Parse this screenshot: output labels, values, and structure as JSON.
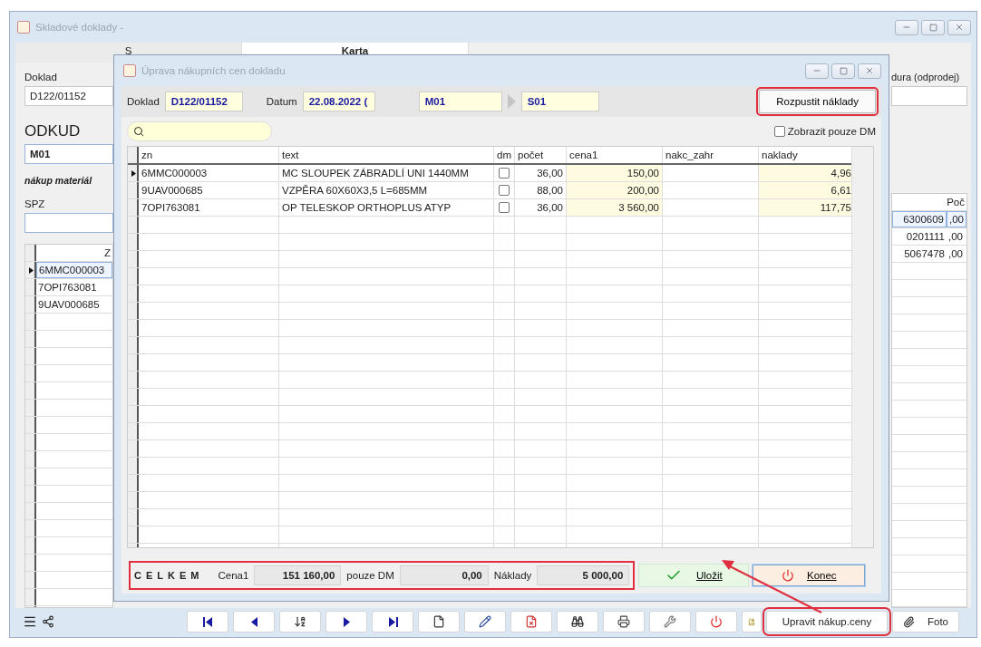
{
  "main_window": {
    "title": "Skladové doklady -",
    "tabs": [
      {
        "label": "S",
        "selected": false
      },
      {
        "label": "Karta",
        "selected": true
      }
    ],
    "left_panel": {
      "doklad_label": "Doklad",
      "doklad_value": "D122/01152",
      "odkud_label": "ODKUD",
      "odkud_value": "M01",
      "note": "nákup materiál",
      "spz_label": "SPZ",
      "grid_header": "Z",
      "rows": [
        {
          "code": "6MMC000003",
          "selected": true
        },
        {
          "code": "7OPI763081",
          "selected": false
        },
        {
          "code": "9UAV000685",
          "selected": false
        }
      ]
    },
    "right_panel": {
      "label": "dura (odprodej)",
      "grid_header": "Poč",
      "rows": [
        {
          "column_1": "6300609",
          "column_2": ",00",
          "selected": true
        },
        {
          "column_1": "0201111",
          "column_2": ",00",
          "selected": false
        },
        {
          "column_1": "5067478",
          "column_2": ",00",
          "selected": false
        }
      ]
    },
    "toolbar": {
      "nav_buttons": [
        {
          "kind": "first"
        },
        {
          "kind": "prev"
        },
        {
          "kind": "sort"
        },
        {
          "kind": "next"
        },
        {
          "kind": "last"
        },
        {
          "kind": "new"
        },
        {
          "kind": "edit"
        },
        {
          "kind": "delete"
        },
        {
          "kind": "find"
        },
        {
          "kind": "print"
        },
        {
          "kind": "tools"
        },
        {
          "kind": "power"
        }
      ],
      "action_button": {
        "label": "Upravit nákup.ceny",
        "highlighted": true
      },
      "foto_button": {
        "label": "Foto"
      }
    }
  },
  "dialog": {
    "title": "Úprava nákupních cen dokladu",
    "doklad_label": "Doklad",
    "doklad_value": "D122/01152",
    "datum_label": "Datum",
    "datum_value": "22.08.2022 (",
    "from_value": "M01",
    "to_value": "S01",
    "dissolve_button": {
      "label": "Rozpustit náklady",
      "highlighted": true
    },
    "show_dm_only": {
      "label": "Zobrazit pouze DM",
      "checked": false
    },
    "columns": [
      "zn",
      "text",
      "dm",
      "počet",
      "cena1",
      "nakc_zahr",
      "naklady"
    ],
    "rows": [
      {
        "zn": "6MMC000003",
        "text": "MC SLOUPEK ZÁBRADLÍ UNI 1440MM",
        "dm": false,
        "pocet": "36,00",
        "cena1": "150,00",
        "naklady": "4,96",
        "current": true
      },
      {
        "zn": "9UAV000685",
        "text": "VZPĚRA 60X60X3,5 L=685MM",
        "dm": false,
        "pocet": "88,00",
        "cena1": "200,00",
        "naklady": "6,61",
        "current": false
      },
      {
        "zn": "7OPI763081",
        "text": "OP TELESKOP ORTHOPLUS ATYP",
        "dm": false,
        "pocet": "36,00",
        "cena1": "3 560,00",
        "naklady": "117,75",
        "current": false
      }
    ],
    "totals": {
      "title": "CELKEM",
      "highlighted": true,
      "cena1_label": "Cena1",
      "cena1_value": "151 160,00",
      "dm_label": "pouze DM",
      "dm_value": "0,00",
      "naklady_label": "Náklady",
      "naklady_value": "5 000,00"
    },
    "save_button": {
      "label": "Uložit"
    },
    "close_button": {
      "label": "Konec"
    }
  },
  "annotation": {
    "kind": "arrow"
  }
}
